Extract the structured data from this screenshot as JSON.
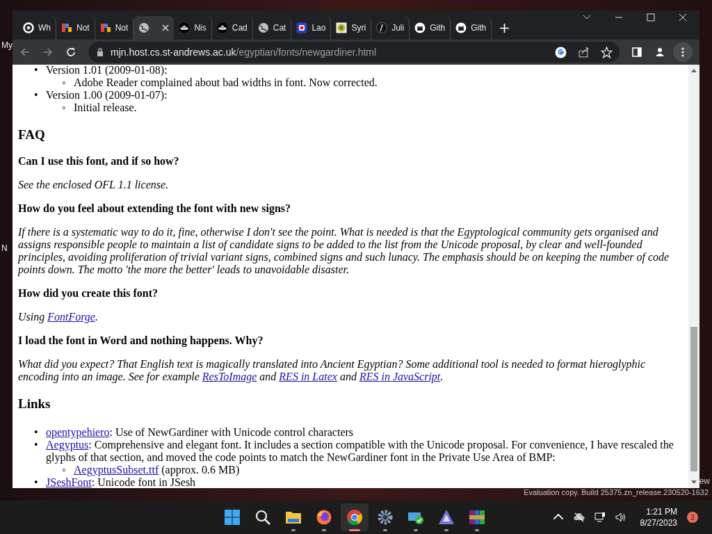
{
  "desktop": {
    "left_labels": [
      "My",
      "N"
    ],
    "right_label": "ew",
    "watermark_text": "Evaluation copy. Build 25375.zn_release.230520-1632"
  },
  "browser": {
    "tabs": [
      {
        "label": "Wh",
        "selected": false
      },
      {
        "label": "Not",
        "selected": false
      },
      {
        "label": "Not",
        "selected": false
      },
      {
        "selected": true
      },
      {
        "label": "Nis",
        "selected": false
      },
      {
        "label": "Cad",
        "selected": false
      },
      {
        "label": "Cat",
        "selected": false
      },
      {
        "label": "Lao",
        "selected": false
      },
      {
        "label": "Syri",
        "selected": false
      },
      {
        "label": "Juli",
        "selected": false
      },
      {
        "label": "Gith",
        "selected": false
      },
      {
        "label": "Gith",
        "selected": false
      }
    ],
    "address": {
      "host": "mjn.host.cs.st-andrews.ac.uk",
      "path": "/egyptian/fonts/newgardiner.html"
    }
  },
  "page": {
    "blocks": [
      {
        "kind": "list",
        "items": [
          {
            "marker": "•",
            "text": "Version 1.01 (2009-01-08):",
            "children": [
              {
                "marker": "◦",
                "text": "Adobe Reader complained about bad widths in font. Now corrected."
              }
            ]
          },
          {
            "marker": "•",
            "text": "Version 1.00 (2009-01-07):",
            "children": [
              {
                "marker": "◦",
                "text": "Initial release."
              }
            ]
          }
        ]
      },
      {
        "kind": "h2",
        "text": "FAQ"
      },
      {
        "kind": "h3",
        "text": "Can I use this font, and if so how?"
      },
      {
        "kind": "p",
        "segments": [
          {
            "text": "See the enclosed OFL 1.1 license."
          }
        ]
      },
      {
        "kind": "h3",
        "text": "How do you feel about extending the font with new signs?"
      },
      {
        "kind": "p",
        "segments": [
          {
            "text": "If there is a systematic way to do it, fine, otherwise I don't see the point. What is needed is that the Egyptological community gets organised and assigns responsible people to maintain a list of candidate signs to be added to the list from the Unicode proposal, by clear and well-founded principles, avoiding proliferation of trivial variant signs, combined signs and such lunacy. The emphasis should be on keeping the number of code points down. The motto 'the more the better' leads to unavoidable disaster."
          }
        ]
      },
      {
        "kind": "h3",
        "text": "How did you create this font?"
      },
      {
        "kind": "p",
        "segments": [
          {
            "text": "Using "
          },
          {
            "link": "FontForge"
          },
          {
            "text": "."
          }
        ]
      },
      {
        "kind": "h3",
        "text": "I load the font in Word and nothing happens. Why?"
      },
      {
        "kind": "p",
        "segments": [
          {
            "text": "What did you expect? That English text is magically translated into Ancient Egyptian? Some additional tool is needed to format hieroglyphic encoding into an image. See for example "
          },
          {
            "link": "ResToImage"
          },
          {
            "text": " and "
          },
          {
            "link": "RES in Latex"
          },
          {
            "text": " and "
          },
          {
            "link": "RES in JavaScript"
          },
          {
            "text": "."
          }
        ]
      },
      {
        "kind": "h2",
        "text": "Links"
      },
      {
        "kind": "links",
        "items": [
          {
            "marker": "•",
            "link": "opentypehiero",
            "text": ": Use of NewGardiner with Unicode control characters"
          },
          {
            "marker": "•",
            "link": "Aegyptus",
            "text": ": Comprehensive and elegant font. It includes a section compatible with the Unicode proposal. For convenience, I have rescaled the glyphs of that section, and moved the code points to match the NewGardiner font in the Private Use Area of BMP:",
            "children": [
              {
                "marker": "◦",
                "link": "AegyptusSubset.ttf",
                "text": " (approx. 0.6 MB)"
              }
            ]
          },
          {
            "marker": "•",
            "link": "JSeshFont",
            "text": ": Unicode font in JSesh"
          }
        ]
      }
    ]
  },
  "taskbar": {
    "apps": [
      {
        "running": false,
        "selected": false
      },
      {
        "running": false,
        "selected": false
      },
      {
        "running": true,
        "selected": false
      },
      {
        "running": true,
        "selected": false
      },
      {
        "running": true,
        "selected": true
      },
      {
        "running": true,
        "selected": false
      },
      {
        "running": true,
        "selected": false
      },
      {
        "running": true,
        "selected": false
      },
      {
        "running": true,
        "selected": false
      }
    ],
    "time": "1:21 PM",
    "date": "8/27/2023",
    "badge": "3"
  }
}
